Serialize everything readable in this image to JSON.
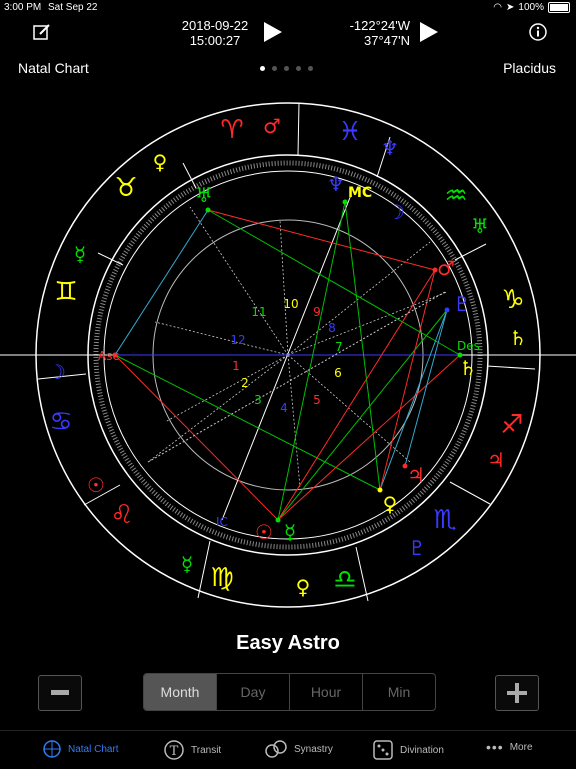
{
  "status": {
    "time": "3:00 PM",
    "date": "Sat Sep 22",
    "battery": "100%"
  },
  "toolbar": {
    "date": "2018-09-22",
    "time": "15:00:27",
    "longitude": "-122°24'W",
    "latitude": "37°47'N"
  },
  "header": {
    "left": "Natal Chart",
    "right": "Placidus",
    "page_count": 5,
    "active_page": 0
  },
  "chart": {
    "angles": {
      "asc": "Asc",
      "mc": "MC",
      "des": "Des",
      "ic": "IC"
    },
    "houses": [
      "1",
      "2",
      "3",
      "4",
      "5",
      "6",
      "7",
      "8",
      "9",
      "10",
      "11",
      "12"
    ]
  },
  "app_name": "Easy Astro",
  "segment": {
    "options": [
      "Month",
      "Day",
      "Hour",
      "Min"
    ],
    "selected": "Month"
  },
  "tabs": [
    {
      "label": "Natal Chart",
      "icon": "natal-chart-icon",
      "active": true
    },
    {
      "label": "Transit",
      "icon": "transit-icon",
      "active": false
    },
    {
      "label": "Synastry",
      "icon": "synastry-icon",
      "active": false
    },
    {
      "label": "Divination",
      "icon": "dice-icon",
      "active": false
    },
    {
      "label": "More",
      "icon": "more-icon",
      "active": false
    }
  ],
  "colors": {
    "fire": "#ff2a2a",
    "earth": "#ffff00",
    "air": "#00e000",
    "water": "#2b2bff",
    "accent": "#2f7df6"
  }
}
